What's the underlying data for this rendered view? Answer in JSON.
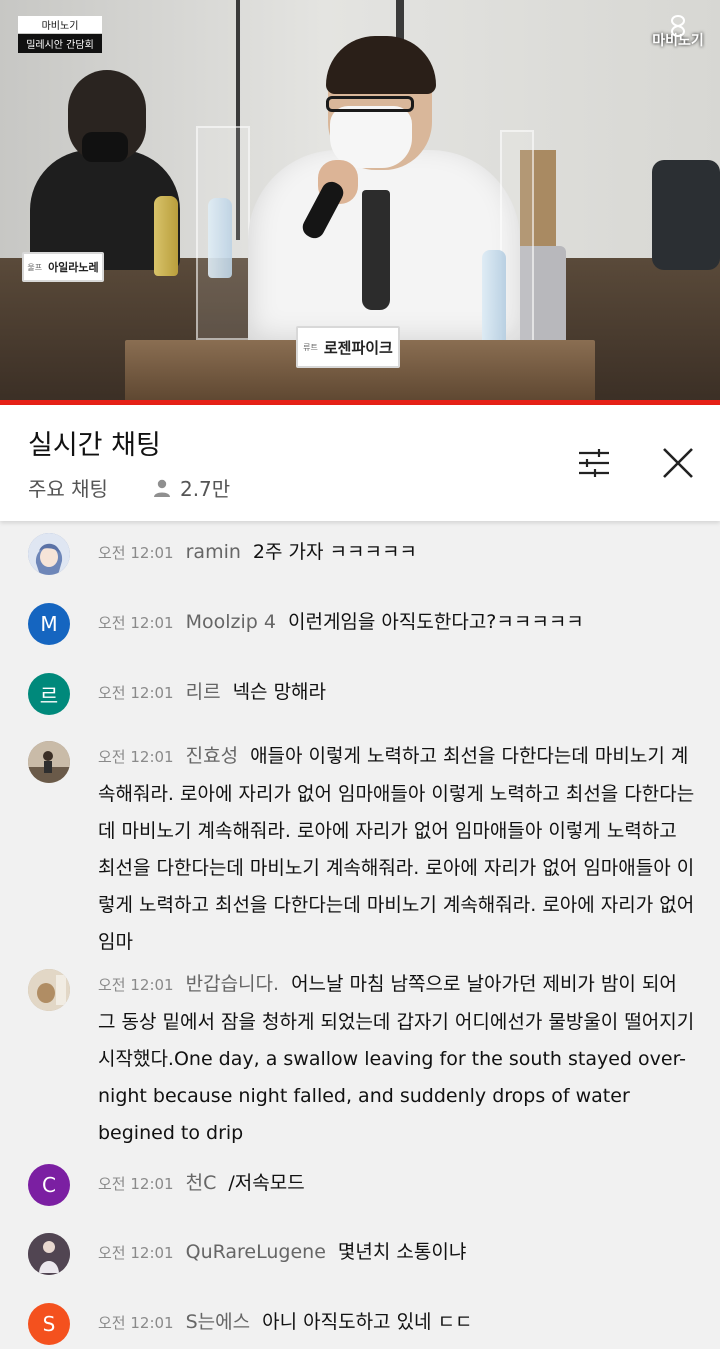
{
  "video": {
    "caption_line1": "마비노기",
    "caption_line2": "밀레시안 간담회",
    "logo_text": "마비노기",
    "nameplate_left": {
      "tag": "울프",
      "name": "아일라노레"
    },
    "nameplate_main": {
      "tag": "류트",
      "name": "로젠파이크"
    },
    "progress_fraction": 1.0,
    "progress_color": "#e62117"
  },
  "chat_header": {
    "title": "실시간 채팅",
    "mode": "주요 채팅",
    "viewer_count": "2.7만",
    "filter_icon": "sliders-icon",
    "close_icon": "close-icon"
  },
  "messages": [
    {
      "time": "오전 12:01",
      "author": "ramin",
      "text": "2주 가자 ㅋㅋㅋㅋㅋ",
      "avatar": {
        "type": "image",
        "color": "#7c8fb5"
      }
    },
    {
      "time": "오전 12:01",
      "author": "Moolzip 4",
      "text": "이런게임을 아직도한다고?ㅋㅋㅋㅋㅋ",
      "avatar": {
        "type": "letter",
        "letter": "M",
        "color": "#1565c0"
      }
    },
    {
      "time": "오전 12:01",
      "author": "리르",
      "text": "넥슨 망해라",
      "avatar": {
        "type": "letter",
        "letter": "르",
        "color": "#00897b"
      }
    },
    {
      "time": "오전 12:01",
      "author": "진효성",
      "text": "애들아 이렇게 노력하고 최선을 다한다는데 마비노기 계속해줘라. 로아에 자리가 없어 임마애들아 이렇게 노력하고 최선을 다한다는데 마비노기 계속해줘라. 로아에 자리가 없어 임마애들아 이렇게 노력하고 최선을 다한다는데 마비노기 계속해줘라. 로아에 자리가 없어 임마애들아 이렇게 노력하고 최선을 다한다는데 마비노기 계속해줘라. 로아에 자리가 없어 임마",
      "avatar": {
        "type": "image",
        "color": "#8d7b68"
      }
    },
    {
      "time": "오전 12:01",
      "author": "반갑습니다.",
      "text": "어느날 마침 남쪽으로 날아가던 제비가 밤이 되어 그 동상 밑에서 잠을 청하게 되었는데 갑자기 어디에선가 물방울이 떨어지기 시작했다.One day, a swallow leaving for the south stayed over-night because night falled, and suddenly drops of water begined to drip",
      "avatar": {
        "type": "image",
        "color": "#b8a58c"
      }
    },
    {
      "time": "오전 12:01",
      "author": "천C",
      "text": "/저속모드",
      "avatar": {
        "type": "letter",
        "letter": "C",
        "color": "#7b1fa2"
      }
    },
    {
      "time": "오전 12:01",
      "author": "QuRareLugene",
      "text": "몇년치 소통이냐",
      "avatar": {
        "type": "image",
        "color": "#6d5a6e"
      }
    },
    {
      "time": "오전 12:01",
      "author": "S는에스",
      "text": "아니 아직도하고 있네 ㄷㄷ",
      "avatar": {
        "type": "letter",
        "letter": "S",
        "color": "#f4511e"
      }
    }
  ]
}
